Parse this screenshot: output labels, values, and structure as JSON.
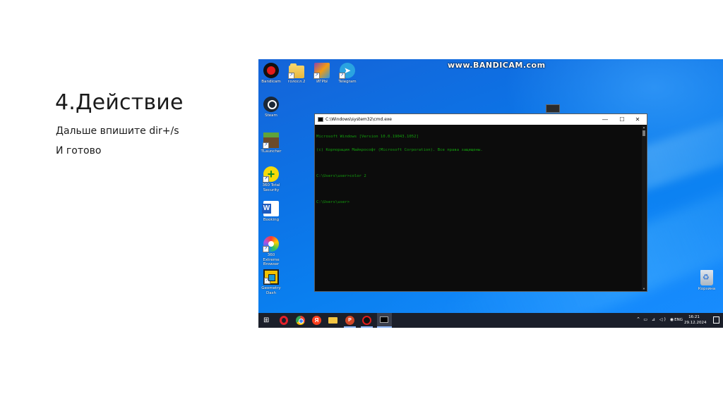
{
  "slide": {
    "title": "4.Действие",
    "line1": "Дальше впишите dir+/s",
    "line2": "И готово"
  },
  "screenshot": {
    "watermark": "www.BANDICAM.com",
    "desktop_icons": [
      {
        "label": "Bandicam",
        "icon": "bandicam-icon"
      },
      {
        "label": "голосл.2",
        "icon": "folder-icon"
      },
      {
        "label": "ИГРЫ",
        "icon": "games-icon"
      },
      {
        "label": "Telegram",
        "icon": "telegram-icon"
      },
      {
        "label": "Steam",
        "icon": "steam-icon"
      },
      {
        "label": "TLauncher",
        "icon": "minecraft-icon"
      },
      {
        "label": "360 Total Security",
        "icon": "antivirus-icon"
      },
      {
        "label": "Booking",
        "icon": "word-document-icon"
      },
      {
        "label": "360 Extreme Browser",
        "icon": "browser-icon"
      },
      {
        "label": "Geometry Dash",
        "icon": "geometry-dash-icon"
      },
      {
        "label": "Корзина",
        "icon": "recycle-bin-icon"
      }
    ],
    "cmd": {
      "title": "C:\\Windows\\system32\\cmd.exe",
      "lines": [
        "Microsoft Windows [Version 10.0.19043.1052]",
        "(c) Корпорация Майкрософт (Microsoft Corporation). Все права защищены.",
        "",
        "C:\\Users\\user>color 2",
        "",
        "C:\\Users\\user>"
      ],
      "text_color": "#13a10e",
      "minimize_glyph": "—",
      "maximize_glyph": "☐",
      "close_glyph": "✕"
    },
    "taskbar": {
      "start_glyph": "⊞",
      "yandex_glyph": "Я",
      "ppt_glyph": "P",
      "lang": "ENG",
      "time": "16:21",
      "date": "29.12.2024",
      "chevron_glyph": "⌃",
      "tray_icons_glyph": "▭ ⊿ ◁) ◉"
    }
  }
}
